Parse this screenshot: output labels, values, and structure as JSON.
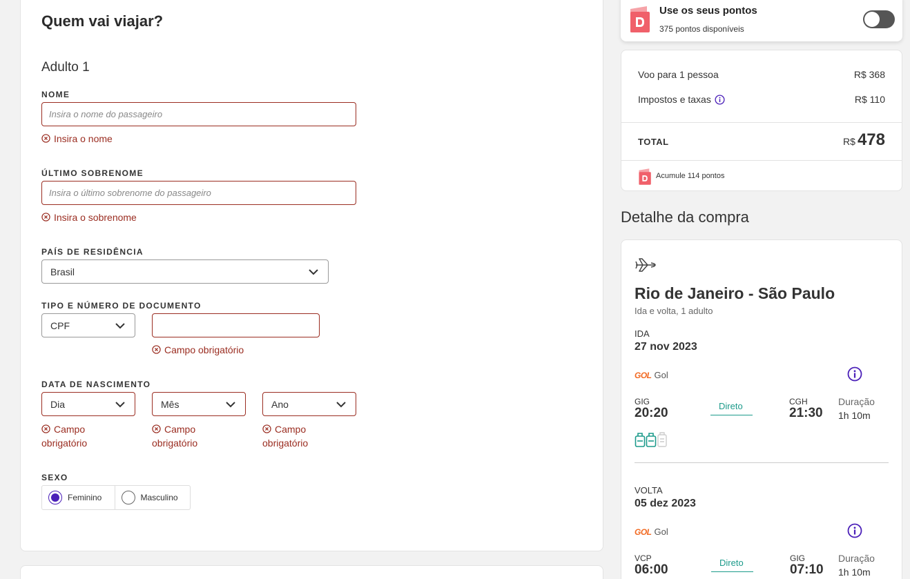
{
  "form": {
    "title": "Quem vai viajar?",
    "passenger_label": "Adulto 1",
    "name": {
      "label": "NOME",
      "placeholder": "Insira o nome do passageiro",
      "error": "Insira o nome"
    },
    "surname": {
      "label": "ÚLTIMO SOBRENOME",
      "placeholder": "Insira o último sobrenome do passageiro",
      "error": "Insira o sobrenome"
    },
    "country": {
      "label": "PAÍS DE RESIDÊNCIA",
      "value": "Brasil"
    },
    "document": {
      "label": "TIPO E NÚMERO DE DOCUMENTO",
      "type_value": "CPF",
      "number_value": "",
      "error": "Campo obrigatório"
    },
    "birth": {
      "label": "DATA DE NASCIMENTO",
      "day": "Dia",
      "month": "Mês",
      "year": "Ano",
      "error_line1": "Campo",
      "error_line2": "obrigatório"
    },
    "sex": {
      "label": "SEXO",
      "options": [
        "Feminino",
        "Masculino"
      ],
      "selected": "Feminino"
    }
  },
  "points": {
    "title": "Use os seus pontos",
    "available": "375 pontos disponíveis",
    "enabled": false
  },
  "price": {
    "flight_label": "Voo para 1 pessoa",
    "flight_value": "R$ 368",
    "taxes_label": "Impostos e taxas",
    "taxes_value": "R$ 110",
    "total_label": "TOTAL",
    "total_currency": "R$",
    "total_value": "478",
    "earn_points": "Acumule 114 pontos"
  },
  "detail": {
    "heading": "Detalhe da compra",
    "route": "Rio de Janeiro - São Paulo",
    "trip_info": "Ida e volta, 1 adulto",
    "outbound": {
      "label": "IDA",
      "date": "27 nov 2023",
      "airline": "Gol",
      "airline_logo": "GOL",
      "from_code": "GIG",
      "from_time": "20:20",
      "stops": "Direto",
      "to_code": "CGH",
      "to_time": "21:30",
      "duration_label": "Duração",
      "duration": "1h 10m"
    },
    "return": {
      "label": "VOLTA",
      "date": "05 dez 2023",
      "airline": "Gol",
      "airline_logo": "GOL",
      "from_code": "VCP",
      "from_time": "06:00",
      "stops": "Direto",
      "to_code": "GIG",
      "to_time": "07:10",
      "duration_label": "Duração",
      "duration": "1h 10m"
    }
  },
  "colors": {
    "error": "#9a2c20",
    "accent": "#4a1fb8",
    "direct": "#1b9a8a",
    "gol": "#f26a22",
    "points_brand": "#f0606a"
  }
}
